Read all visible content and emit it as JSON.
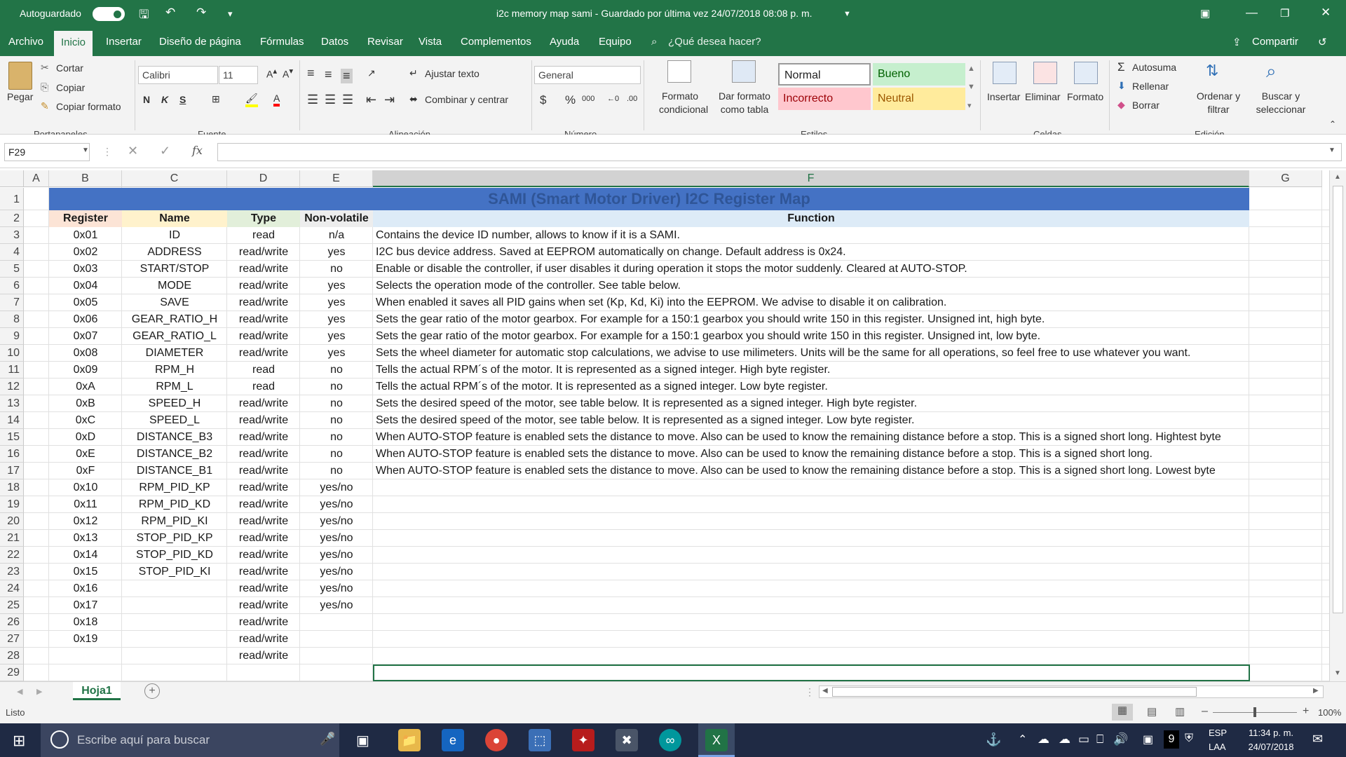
{
  "titlebar": {
    "autosave_label": "Autoguardado",
    "title": "i2c memory map sami  -  Guardado por última vez 24/07/2018 08:08 p. m."
  },
  "menu": {
    "items": [
      "Archivo",
      "Inicio",
      "Insertar",
      "Diseño de página",
      "Fórmulas",
      "Datos",
      "Revisar",
      "Vista",
      "Complementos",
      "Ayuda",
      "Equipo"
    ],
    "tell_me": "¿Qué desea hacer?",
    "share": "Compartir"
  },
  "ribbon": {
    "clipboard": {
      "paste": "Pegar",
      "cut": "Cortar",
      "copy": "Copiar",
      "format_painter": "Copiar formato",
      "group": "Portapapeles"
    },
    "font": {
      "name": "Calibri",
      "size": "11",
      "bold": "N",
      "italic": "K",
      "underline": "S",
      "group": "Fuente"
    },
    "alignment": {
      "wrap": "Ajustar texto",
      "merge": "Combinar y centrar",
      "group": "Alineación"
    },
    "number": {
      "format": "General",
      "group": "Número"
    },
    "styles": {
      "conditional": "Formato condicional",
      "as_table": "Dar formato como tabla",
      "normal": "Normal",
      "good": "Bueno",
      "bad": "Incorrecto",
      "neutral": "Neutral",
      "group": "Estilos"
    },
    "cells": {
      "insert": "Insertar",
      "delete": "Eliminar",
      "format": "Formato",
      "group": "Celdas"
    },
    "editing": {
      "autosum": "Autosuma",
      "fill": "Rellenar",
      "clear": "Borrar",
      "sort": "Ordenar y filtrar",
      "find": "Buscar y seleccionar",
      "group": "Edición"
    }
  },
  "formula_bar": {
    "name_box": "F29",
    "fx": "fx",
    "value": ""
  },
  "columns": [
    "A",
    "B",
    "C",
    "D",
    "E",
    "F",
    "G"
  ],
  "sheet": {
    "title": "SAMI (Smart Motor Driver) I2C Register Map",
    "headers": [
      "Register",
      "Name",
      "Type",
      "Non-volatile",
      "Function"
    ],
    "rows": [
      [
        "0x01",
        "ID",
        "read",
        "n/a",
        "Contains the device ID number, allows to know if it is a SAMI."
      ],
      [
        "0x02",
        "ADDRESS",
        "read/write",
        "yes",
        "I2C bus device address. Saved at EEPROM automatically on change. Default address is 0x24."
      ],
      [
        "0x03",
        "START/STOP",
        "read/write",
        "no",
        "Enable or disable the controller, if user disables it during operation it stops the motor suddenly. Cleared at AUTO-STOP."
      ],
      [
        "0x04",
        "MODE",
        "read/write",
        "yes",
        "Selects the operation mode of the controller. See table below."
      ],
      [
        "0x05",
        "SAVE",
        "read/write",
        "yes",
        "When enabled it saves all PID gains when set (Kp, Kd, Ki) into the EEPROM. We advise to disable it on calibration."
      ],
      [
        "0x06",
        "GEAR_RATIO_H",
        "read/write",
        "yes",
        "Sets the gear ratio of the motor gearbox. For example for a 150:1 gearbox you should write 150 in this register. Unsigned int, high byte."
      ],
      [
        "0x07",
        "GEAR_RATIO_L",
        "read/write",
        "yes",
        "Sets the gear ratio of the motor gearbox. For example for a 150:1 gearbox you should write 150 in this register. Unsigned int, low byte."
      ],
      [
        "0x08",
        "DIAMETER",
        "read/write",
        "yes",
        "Sets the wheel diameter for automatic stop calculations, we advise to use milimeters. Units will be the same for all operations, so feel free to use whatever you want."
      ],
      [
        "0x09",
        "RPM_H",
        "read",
        "no",
        "Tells the actual RPM´s of the motor. It is represented as a signed integer. High byte register."
      ],
      [
        "0xA",
        "RPM_L",
        "read",
        "no",
        "Tells the actual RPM´s of the motor. It is represented as a signed integer. Low byte register."
      ],
      [
        "0xB",
        "SPEED_H",
        "read/write",
        "no",
        "Sets the desired speed of the motor,  see table below. It is represented as a signed integer. High byte register."
      ],
      [
        "0xC",
        "SPEED_L",
        "read/write",
        "no",
        "Sets the desired speed of the motor,  see table below. It is represented as a signed integer. Low byte register."
      ],
      [
        "0xD",
        "DISTANCE_B3",
        "read/write",
        "no",
        "When AUTO-STOP feature is enabled sets the distance to move. Also can be used to know the remaining distance before a stop. This is a signed short long. Hightest byte"
      ],
      [
        "0xE",
        "DISTANCE_B2",
        "read/write",
        "no",
        "When AUTO-STOP feature is enabled sets the distance to move. Also can be used to know the remaining distance before a stop. This is a signed short long."
      ],
      [
        "0xF",
        "DISTANCE_B1",
        "read/write",
        "no",
        "When AUTO-STOP feature is enabled sets the distance to move. Also can be used to know the remaining distance before a stop. This is a signed short long. Lowest byte"
      ],
      [
        "0x10",
        "RPM_PID_KP",
        "read/write",
        "yes/no",
        ""
      ],
      [
        "0x11",
        "RPM_PID_KD",
        "read/write",
        "yes/no",
        ""
      ],
      [
        "0x12",
        "RPM_PID_KI",
        "read/write",
        "yes/no",
        ""
      ],
      [
        "0x13",
        "STOP_PID_KP",
        "read/write",
        "yes/no",
        ""
      ],
      [
        "0x14",
        "STOP_PID_KD",
        "read/write",
        "yes/no",
        ""
      ],
      [
        "0x15",
        "STOP_PID_KI",
        "read/write",
        "yes/no",
        ""
      ],
      [
        "0x16",
        "",
        "read/write",
        "yes/no",
        ""
      ],
      [
        "0x17",
        "",
        "read/write",
        "yes/no",
        ""
      ],
      [
        "0x18",
        "",
        "read/write",
        "",
        ""
      ],
      [
        "0x19",
        "",
        "read/write",
        "",
        ""
      ],
      [
        "",
        "",
        "read/write",
        "",
        ""
      ],
      [
        "",
        "",
        "",
        "",
        ""
      ]
    ]
  },
  "sheet_tab": "Hoja1",
  "status": {
    "ready": "Listo",
    "zoom": "100%"
  },
  "taskbar": {
    "search_placeholder": "Escribe aquí para buscar",
    "lang1": "ESP",
    "lang2": "LAA",
    "time": "11:34 p. m.",
    "date": "24/07/2018",
    "badge": "9"
  },
  "colors": {
    "excel_green": "#227447",
    "title_fill": "#4472c4",
    "register_hdr": "#fce4d6",
    "name_hdr": "#fff2cc",
    "type_hdr": "#e2efda",
    "nv_hdr": "#ededed",
    "function_hdr": "#ddebf7"
  }
}
